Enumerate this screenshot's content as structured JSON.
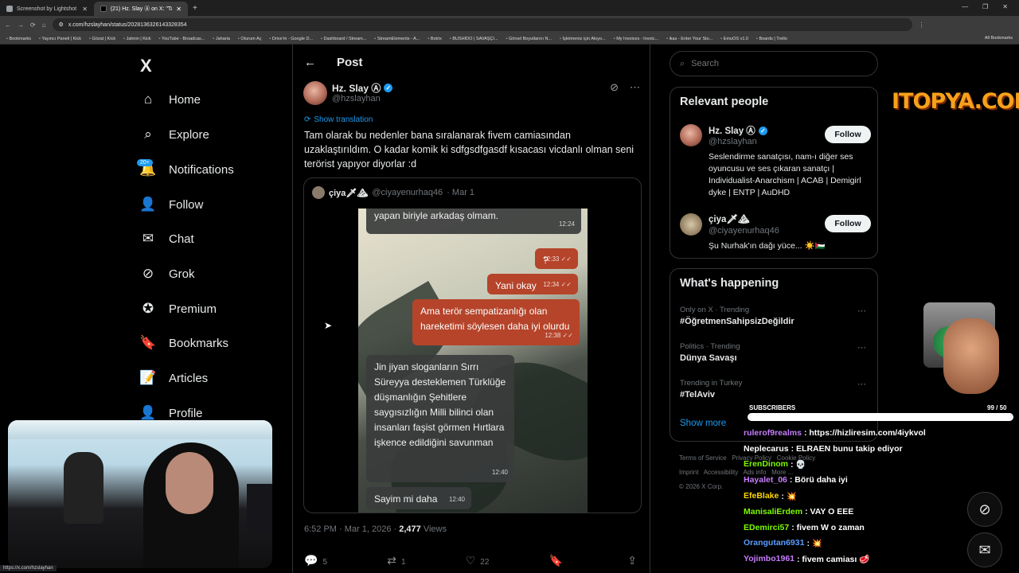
{
  "browser": {
    "tabs": [
      {
        "label": "Screenshot by Lightshot",
        "active": false
      },
      {
        "label": "(21) Hz. Slay Ⓐ on X: \"Tam olara...",
        "active": true
      }
    ],
    "url": "x.com/hzslayhan/status/2028136326143328354",
    "bookmarks": [
      "Bookmarks",
      "Yayıncı Paneli | Kick",
      "Gözat | Kick",
      "Jahnin | Kick",
      "YouTube - Broadcas...",
      "Jaharia",
      "Oturum Aç",
      "Drive'm - Google D...",
      "Dashboard / Stream...",
      "StreamElements - A...",
      "Botrix",
      "BUSHIDO | SAVAŞÇI...",
      "Görsel Boyutlarını N...",
      "İşletmeniz için Akıyo...",
      "My Invoices - Invoic...",
      "ikas - Enter Your Sto...",
      "EmuOS v1.0",
      "Boards | Trello"
    ],
    "all_bookmarks": "All Bookmarks",
    "status_url": "https://x.com/hzslayhan"
  },
  "sidebar": {
    "logo": "X",
    "notif_badge": "20+",
    "items": [
      {
        "label": "Home",
        "icon": "home-icon",
        "glyph": "⌂"
      },
      {
        "label": "Explore",
        "icon": "search-icon",
        "glyph": "⌕"
      },
      {
        "label": "Notifications",
        "icon": "bell-icon",
        "glyph": "🔔"
      },
      {
        "label": "Follow",
        "icon": "person-add-icon",
        "glyph": "👤"
      },
      {
        "label": "Chat",
        "icon": "mail-icon",
        "glyph": "✉"
      },
      {
        "label": "Grok",
        "icon": "grok-icon",
        "glyph": "⊘"
      },
      {
        "label": "Premium",
        "icon": "verified-icon",
        "glyph": "✪"
      },
      {
        "label": "Bookmarks",
        "icon": "bookmark-icon",
        "glyph": "🔖"
      },
      {
        "label": "Articles",
        "icon": "articles-icon",
        "glyph": "📝"
      },
      {
        "label": "Profile",
        "icon": "profile-icon",
        "glyph": "👤"
      }
    ]
  },
  "post": {
    "header": "Post",
    "author_name": "Hz. Slay Ⓐ",
    "author_handle": "@hzslayhan",
    "show_translation": "Show translation",
    "text": "Tam olarak bu nedenler bana sıralanarak fivem camiasından uzaklaştırıldım. O kadar komik ki sdfgsdfgasdf kısacası vicdanlı olman seni terörist yapıyor diyorlar :d",
    "quote": {
      "name": "çiya🗡⛰",
      "handle": "@ciyayenurhaq46",
      "date": "· Mar 1",
      "messages": [
        {
          "dir": "in",
          "text": "yapan biriyle arkadaş olmam.",
          "time": "12:24"
        },
        {
          "dir": "out",
          "text": "?",
          "time": "12:33 ✓✓"
        },
        {
          "dir": "out",
          "text": "Yani okay",
          "time": "12:34 ✓✓"
        },
        {
          "dir": "out",
          "text": "Ama terör sempatizanlığı olan hareketimi söylesen daha iyi olurdu",
          "time": "12:38 ✓✓"
        },
        {
          "dir": "in",
          "text": "Jin jiyan sloganların Sırrı Süreyya desteklemen Türklüğe düşmanlığın Şehitlere saygısızlığın Milli bilinci olan insanları faşist görmen Hırtlara işkence edildiğini savunman",
          "time": "12:40"
        },
        {
          "dir": "in",
          "text": "Sayim mi daha",
          "time": "12:40"
        }
      ]
    },
    "timestamp": "6:52 PM · Mar 1, 2026 ·",
    "views_count": "2,477",
    "views_label": "Views",
    "replies": "5",
    "reposts": "1",
    "likes": "22"
  },
  "right": {
    "search_placeholder": "Search",
    "relevant_title": "Relevant people",
    "people": [
      {
        "name": "Hz. Slay Ⓐ",
        "handle": "@hzslayhan",
        "bio": "Seslendirme sanatçısı, nam-ı diğer ses oyuncusu ve ses çıkaran sanatçı | Individualist-Anarchism | ACAB | Demigirl dyke | ENTP | AuDHD",
        "follow": "Follow",
        "verified": true
      },
      {
        "name": "çiya🗡⛰",
        "handle": "@ciyayenurhaq46",
        "bio": "Şu Nurhak'ın dağı yüce... ☀️🇵🇸",
        "follow": "Follow",
        "verified": false
      }
    ],
    "happening_title": "What's happening",
    "trends": [
      {
        "category": "Only on X · Trending",
        "title": "#ÖğretmenSahipsizDeğildir"
      },
      {
        "category": "Politics · Trending",
        "title": "Dünya Savaşı"
      },
      {
        "category": "Trending in Turkey",
        "title": "#TelAviv"
      }
    ],
    "show_more": "Show more",
    "footer": [
      "Terms of Service",
      "Privacy Policy",
      "Cookie Policy",
      "Imprint",
      "Accessibility",
      "Ads info",
      "More ...",
      "© 2026 X Corp."
    ]
  },
  "overlay": {
    "logo_text": "ITOPYA.COM",
    "subs_label": "SUBSCRIBERS",
    "subs_count": "99 / 50",
    "subs_fraction": 1.0,
    "chat": [
      {
        "user": "rulerof9realms",
        "color": "#c77dff",
        "msg": "https://hizliresim.com/4iykvol"
      },
      {
        "user": "Neplecarus",
        "color": "#ffffff",
        "msg": "ELRAEN bunu takip ediyor"
      },
      {
        "user": "ErenDinom",
        "color": "#7cfc00",
        "msg": "💀"
      },
      {
        "user": "Hayalet_06",
        "color": "#c77dff",
        "msg": "Börü daha iyi"
      },
      {
        "user": "EfeBlake",
        "color": "#ffd700",
        "msg": "💥"
      },
      {
        "user": "ManisaliErdem",
        "color": "#7cfc00",
        "msg": "VAY O EEE"
      },
      {
        "user": "EDemirci57",
        "color": "#7cfc00",
        "msg": "fivem W o zaman"
      },
      {
        "user": "Orangutan6931",
        "color": "#5b9dff",
        "msg": "💥"
      },
      {
        "user": "Yojimbo1961",
        "color": "#c77dff",
        "msg": "fivem camiası 🥩"
      }
    ]
  }
}
